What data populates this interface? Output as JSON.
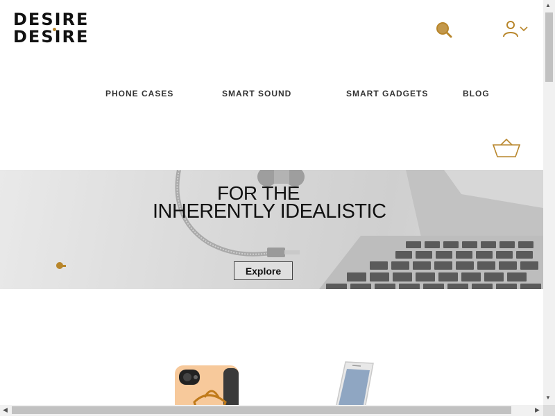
{
  "brand": {
    "logo_line1": "DESIRE",
    "logo_line2": "DESIRE",
    "accent_color": "#b8862b"
  },
  "header": {
    "search_icon": "search-icon",
    "account_icon": "user-icon",
    "account_dropdown_icon": "chevron-down-icon",
    "cart_icon": "basket-icon"
  },
  "nav": {
    "items": [
      {
        "label": "PHONE CASES"
      },
      {
        "label": "SMART SOUND"
      },
      {
        "label": "SMART GADGETS"
      },
      {
        "label": "BLOG"
      }
    ]
  },
  "hero": {
    "headline_line1": "FOR THE",
    "headline_line2": "INHERENTLY IDEALISTIC",
    "cta_label": "Explore",
    "slide_indicator_color": "#b8862b"
  },
  "scrollbars": {
    "up_arrow": "▲",
    "down_arrow": "▼",
    "left_arrow": "◀",
    "right_arrow": "▶"
  }
}
